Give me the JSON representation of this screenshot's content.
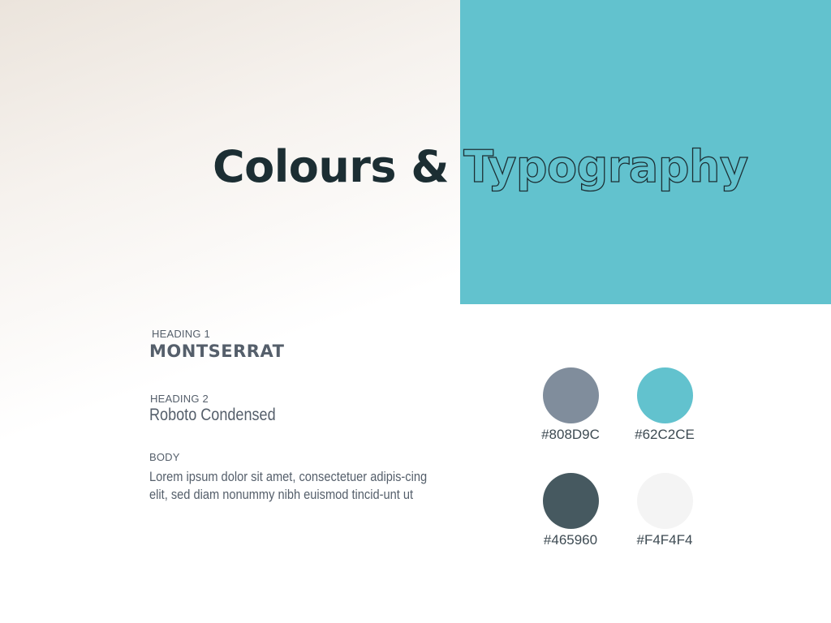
{
  "title": {
    "solid": "Colours & ",
    "outline": "Typography"
  },
  "typography": {
    "heading1": {
      "label": "HEADING 1",
      "sample": "MONTSERRAT"
    },
    "heading2": {
      "label": "HEADING 2",
      "sample": "Roboto Condensed"
    },
    "body": {
      "label": "BODY",
      "sample": "Lorem ipsum dolor sit amet, consectetuer adipis-cing elit, sed diam nonummy nibh euismod tincid-unt ut"
    }
  },
  "colors": [
    {
      "hex": "#808D9C",
      "color": "#808D9C"
    },
    {
      "hex": "#62C2CE",
      "color": "#62C2CE"
    },
    {
      "hex": "#465960",
      "color": "#465960"
    },
    {
      "hex": "#F4F4F4",
      "color": "#F4F4F4"
    }
  ],
  "accent_block_color": "#62C2CE",
  "title_color": "#1c2e33"
}
